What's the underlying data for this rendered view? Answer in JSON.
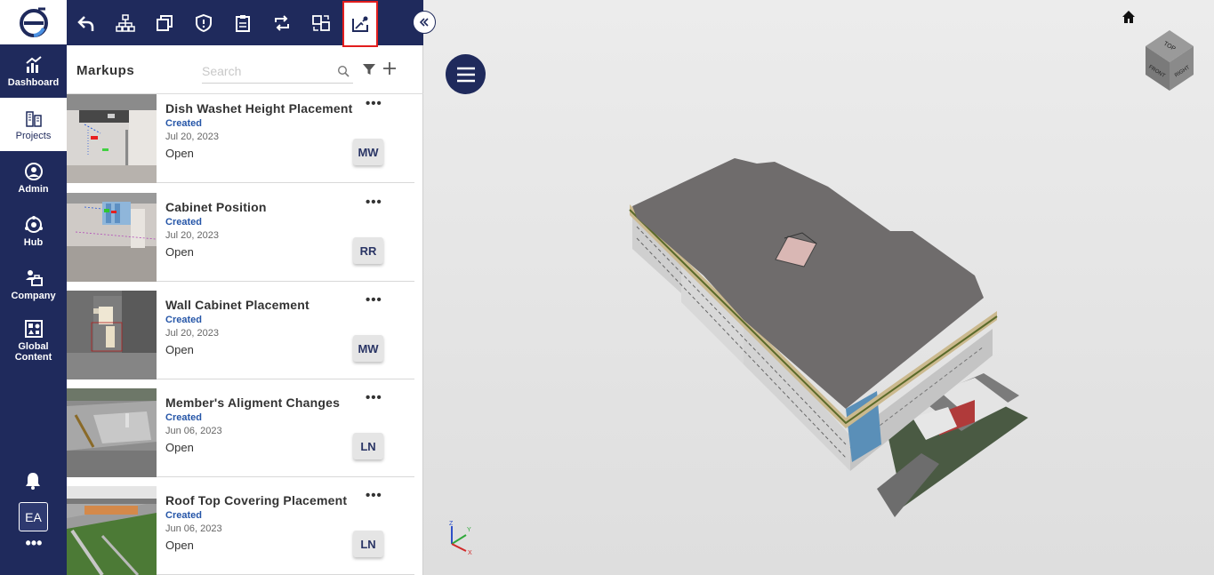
{
  "nav": {
    "items": [
      {
        "label": "Dashboard"
      },
      {
        "label": "Projects"
      },
      {
        "label": "Admin"
      },
      {
        "label": "Hub"
      },
      {
        "label": "Company"
      },
      {
        "label": "Global Content"
      }
    ],
    "user_initials": "EA",
    "more_label": "•••"
  },
  "panel": {
    "title": "Markups",
    "search_placeholder": "Search"
  },
  "markups": [
    {
      "title": "Dish Washet Height Placement",
      "status": "Created",
      "date": "Jul 20, 2023",
      "state": "Open",
      "user": "MW"
    },
    {
      "title": "Cabinet Position",
      "status": "Created",
      "date": "Jul 20, 2023",
      "state": "Open",
      "user": "RR"
    },
    {
      "title": "Wall Cabinet Placement",
      "status": "Created",
      "date": "Jul 20, 2023",
      "state": "Open",
      "user": "MW"
    },
    {
      "title": "Member's Aligment Changes",
      "status": "Created",
      "date": "Jun 06, 2023",
      "state": "Open",
      "user": "LN"
    },
    {
      "title": "Roof Top Covering Placement",
      "status": "Created",
      "date": "Jun 06, 2023",
      "state": "Open",
      "user": "LN"
    }
  ],
  "card_more_label": "•••",
  "viewcube": {
    "top": "TOP",
    "front": "FRONT",
    "right": "RIGHT"
  },
  "axes": {
    "x": "X",
    "y": "Y",
    "z": "Z"
  },
  "colors": {
    "navy": "#1f2a5c",
    "status_blue": "#2656a8",
    "highlight": "#e21d1d"
  }
}
